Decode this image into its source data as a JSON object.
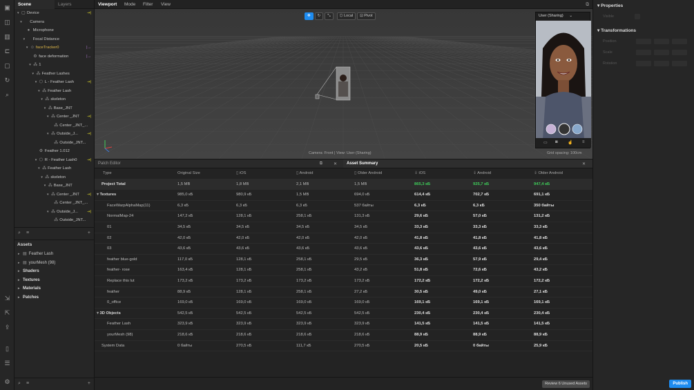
{
  "left_tabs": [
    "Scene",
    "Layers"
  ],
  "menu": [
    "Viewport",
    "Mode",
    "Filter",
    "View"
  ],
  "scene_tree": [
    {
      "label": "Device",
      "level": 0,
      "arrow": "▾",
      "icon": "▢",
      "tag": "⇥|"
    },
    {
      "label": "Camera",
      "level": 1,
      "arrow": "▾",
      "icon": "",
      "tag": ""
    },
    {
      "label": "Microphone",
      "level": 2,
      "arrow": "",
      "icon": "●",
      "tag": ""
    },
    {
      "label": "Focal Distance",
      "level": 2,
      "arrow": "▾",
      "icon": "",
      "tag": ""
    },
    {
      "label": "faceTracker0",
      "level": 3,
      "arrow": "▾",
      "icon": "☺",
      "tag": "|→",
      "yellow": true
    },
    {
      "label": "face deformation",
      "level": 4,
      "arrow": "",
      "icon": "⚙",
      "tag": "|→"
    },
    {
      "label": "1",
      "level": 4,
      "arrow": "▾",
      "icon": "⁂",
      "tag": ""
    },
    {
      "label": "Feather Lashes",
      "level": 5,
      "arrow": "▾",
      "icon": "⁂",
      "tag": ""
    },
    {
      "label": "L - Feather Lash",
      "level": 6,
      "arrow": "▾",
      "icon": "⬡",
      "tag": "⇥|"
    },
    {
      "label": "Feather Lash",
      "level": 7,
      "arrow": "▾",
      "icon": "⁂",
      "tag": ""
    },
    {
      "label": "skeleton",
      "level": 8,
      "arrow": "▾",
      "icon": "⁂",
      "tag": ""
    },
    {
      "label": "Base_JNT",
      "level": 9,
      "arrow": "▾",
      "icon": "⁂",
      "tag": ""
    },
    {
      "label": "Center _JNT",
      "level": 10,
      "arrow": "▾",
      "icon": "⁂",
      "tag": "⇥|"
    },
    {
      "label": "Center _JNT_...",
      "level": 11,
      "arrow": "",
      "icon": "⁂",
      "tag": ""
    },
    {
      "label": "Outside_J...",
      "level": 10,
      "arrow": "▾",
      "icon": "⁂",
      "tag": "⇥|"
    },
    {
      "label": "Outside_JNT...",
      "level": 11,
      "arrow": "",
      "icon": "⁂",
      "tag": ""
    },
    {
      "label": "Feather 1.012",
      "level": 6,
      "arrow": "",
      "icon": "⚙",
      "tag": ""
    },
    {
      "label": "R - Feather Lash0",
      "level": 6,
      "arrow": "▾",
      "icon": "⬡",
      "tag": "⇥|"
    },
    {
      "label": "Feather Lash",
      "level": 7,
      "arrow": "▾",
      "icon": "⁂",
      "tag": ""
    },
    {
      "label": "skeleton",
      "level": 8,
      "arrow": "▾",
      "icon": "⁂",
      "tag": ""
    },
    {
      "label": "Base_JNT",
      "level": 9,
      "arrow": "▾",
      "icon": "⁂",
      "tag": ""
    },
    {
      "label": "Center _JNT",
      "level": 10,
      "arrow": "▾",
      "icon": "⁂",
      "tag": "⇥|"
    },
    {
      "label": "Center _JNT_...",
      "level": 11,
      "arrow": "",
      "icon": "⁂",
      "tag": ""
    },
    {
      "label": "Outside_J...",
      "level": 10,
      "arrow": "▾",
      "icon": "⁂",
      "tag": "⇥|"
    },
    {
      "label": "Outside_JNT...",
      "level": 11,
      "arrow": "",
      "icon": "⁂",
      "tag": ""
    }
  ],
  "assets": {
    "title": "Assets",
    "items": [
      {
        "label": "Feather Lash",
        "bold": false,
        "icon": "▤"
      },
      {
        "label": "yourMesh (98)",
        "bold": false,
        "icon": "▤"
      },
      {
        "label": "Shaders",
        "bold": true,
        "icon": ""
      },
      {
        "label": "Textures",
        "bold": true,
        "icon": ""
      },
      {
        "label": "Materials",
        "bold": true,
        "icon": ""
      },
      {
        "label": "Patches",
        "bold": true,
        "icon": ""
      }
    ]
  },
  "viewport": {
    "tools": {
      "local": "Local",
      "pivot": "Pivot"
    },
    "preview_title": "User (Sharing)",
    "camera_label": "Camera: Front | View: User (Sharing)",
    "grid_label": "Grid spacing: 100cm"
  },
  "patch_editor": "Patch Editor",
  "summary": {
    "title": "Asset Summary",
    "columns": [
      "Type",
      "Original Size",
      "iOS",
      "Android",
      "Older Android",
      "iOS",
      "Android",
      "Older Android"
    ],
    "rows": [
      {
        "name": "Project Total",
        "kind": "total",
        "v": [
          "1,5 MB",
          "1,8 MB",
          "2,1 MB",
          "1,5 MB",
          "865,3 кБ",
          "925,7 кБ",
          "947,4 кБ"
        ]
      },
      {
        "name": "Textures",
        "kind": "group",
        "v": [
          "985,0 кБ",
          "980,9 кБ",
          "1,5 MB",
          "694,0 кБ",
          "614,4 кБ",
          "702,7 кБ",
          "691,1 кБ"
        ]
      },
      {
        "name": "FaceWarpAlphaMap(11)",
        "kind": "item",
        "v": [
          "6,3 кБ",
          "6,3 кБ",
          "6,3 кБ",
          "537 байты",
          "6,3 кБ",
          "6,3 кБ",
          "350 байты"
        ]
      },
      {
        "name": "NormalMap-24",
        "kind": "item",
        "v": [
          "147,2 кБ",
          "128,1 кБ",
          "258,1 кБ",
          "131,3 кБ",
          "29,6 кБ",
          "57,0 кБ",
          "131,2 кБ"
        ]
      },
      {
        "name": "01",
        "kind": "item",
        "v": [
          "34,5 кБ",
          "34,5 кБ",
          "34,5 кБ",
          "34,5 кБ",
          "33,3 кБ",
          "33,3 кБ",
          "33,3 кБ"
        ]
      },
      {
        "name": "02",
        "kind": "item",
        "v": [
          "42,0 кБ",
          "42,0 кБ",
          "42,0 кБ",
          "42,0 кБ",
          "41,8 кБ",
          "41,8 кБ",
          "41,8 кБ"
        ]
      },
      {
        "name": "03",
        "kind": "item",
        "v": [
          "43,6 кБ",
          "43,6 кБ",
          "43,6 кБ",
          "43,6 кБ",
          "43,6 кБ",
          "43,6 кБ",
          "43,6 кБ"
        ]
      },
      {
        "name": "feather blue-gold",
        "kind": "item",
        "v": [
          "117,0 кБ",
          "128,1 кБ",
          "258,1 кБ",
          "29,5 кБ",
          "36,3 кБ",
          "57,9 кБ",
          "29,4 кБ"
        ]
      },
      {
        "name": "feather- rose",
        "kind": "item",
        "v": [
          "163,4 кБ",
          "128,1 кБ",
          "258,1 кБ",
          "43,2 кБ",
          "51,8 кБ",
          "72,6 кБ",
          "43,2 кБ"
        ]
      },
      {
        "name": "Replace this lut",
        "kind": "item",
        "v": [
          "173,2 кБ",
          "173,2 кБ",
          "173,2 кБ",
          "173,2 кБ",
          "172,2 кБ",
          "172,2 кБ",
          "172,2 кБ"
        ]
      },
      {
        "name": "feather",
        "kind": "item",
        "v": [
          "88,9 кБ",
          "128,1 кБ",
          "258,1 кБ",
          "27,2 кБ",
          "30,5 кБ",
          "49,0 кБ",
          "27,1 кБ"
        ]
      },
      {
        "name": "0_office",
        "kind": "item",
        "v": [
          "169,0 кБ",
          "169,0 кБ",
          "169,0 кБ",
          "169,0 кБ",
          "169,1 кБ",
          "169,1 кБ",
          "169,1 кБ"
        ]
      },
      {
        "name": "3D Objects",
        "kind": "group",
        "v": [
          "542,5 кБ",
          "542,5 кБ",
          "542,5 кБ",
          "542,5 кБ",
          "230,4 кБ",
          "230,4 кБ",
          "230,4 кБ"
        ]
      },
      {
        "name": "Feather Lash",
        "kind": "item",
        "v": [
          "323,9 кБ",
          "323,9 кБ",
          "323,9 кБ",
          "323,9 кБ",
          "141,5 кБ",
          "141,5 кБ",
          "141,5 кБ"
        ]
      },
      {
        "name": "yourMesh (98)",
        "kind": "item",
        "v": [
          "218,6 кБ",
          "218,6 кБ",
          "218,6 кБ",
          "218,6 кБ",
          "88,9 кБ",
          "88,9 кБ",
          "88,9 кБ"
        ]
      },
      {
        "name": "System Data",
        "kind": "plain",
        "v": [
          "0 байты",
          "270,5 кБ",
          "111,7 кБ",
          "270,5 кБ",
          "20,5 кБ",
          "0 байты",
          "25,9 кБ"
        ]
      }
    ],
    "review_button": "Review 6 Unused Assets"
  },
  "properties": {
    "title": "Properties",
    "visible": "Visible",
    "transformations": "Transformations",
    "position": "Position",
    "scale": "Scale",
    "rotation": "Rotation"
  },
  "publish": "Publish",
  "colors": {
    "accent": "#1e8cf0",
    "green": "#3fcf5a",
    "yellow": "#e0b94a"
  }
}
